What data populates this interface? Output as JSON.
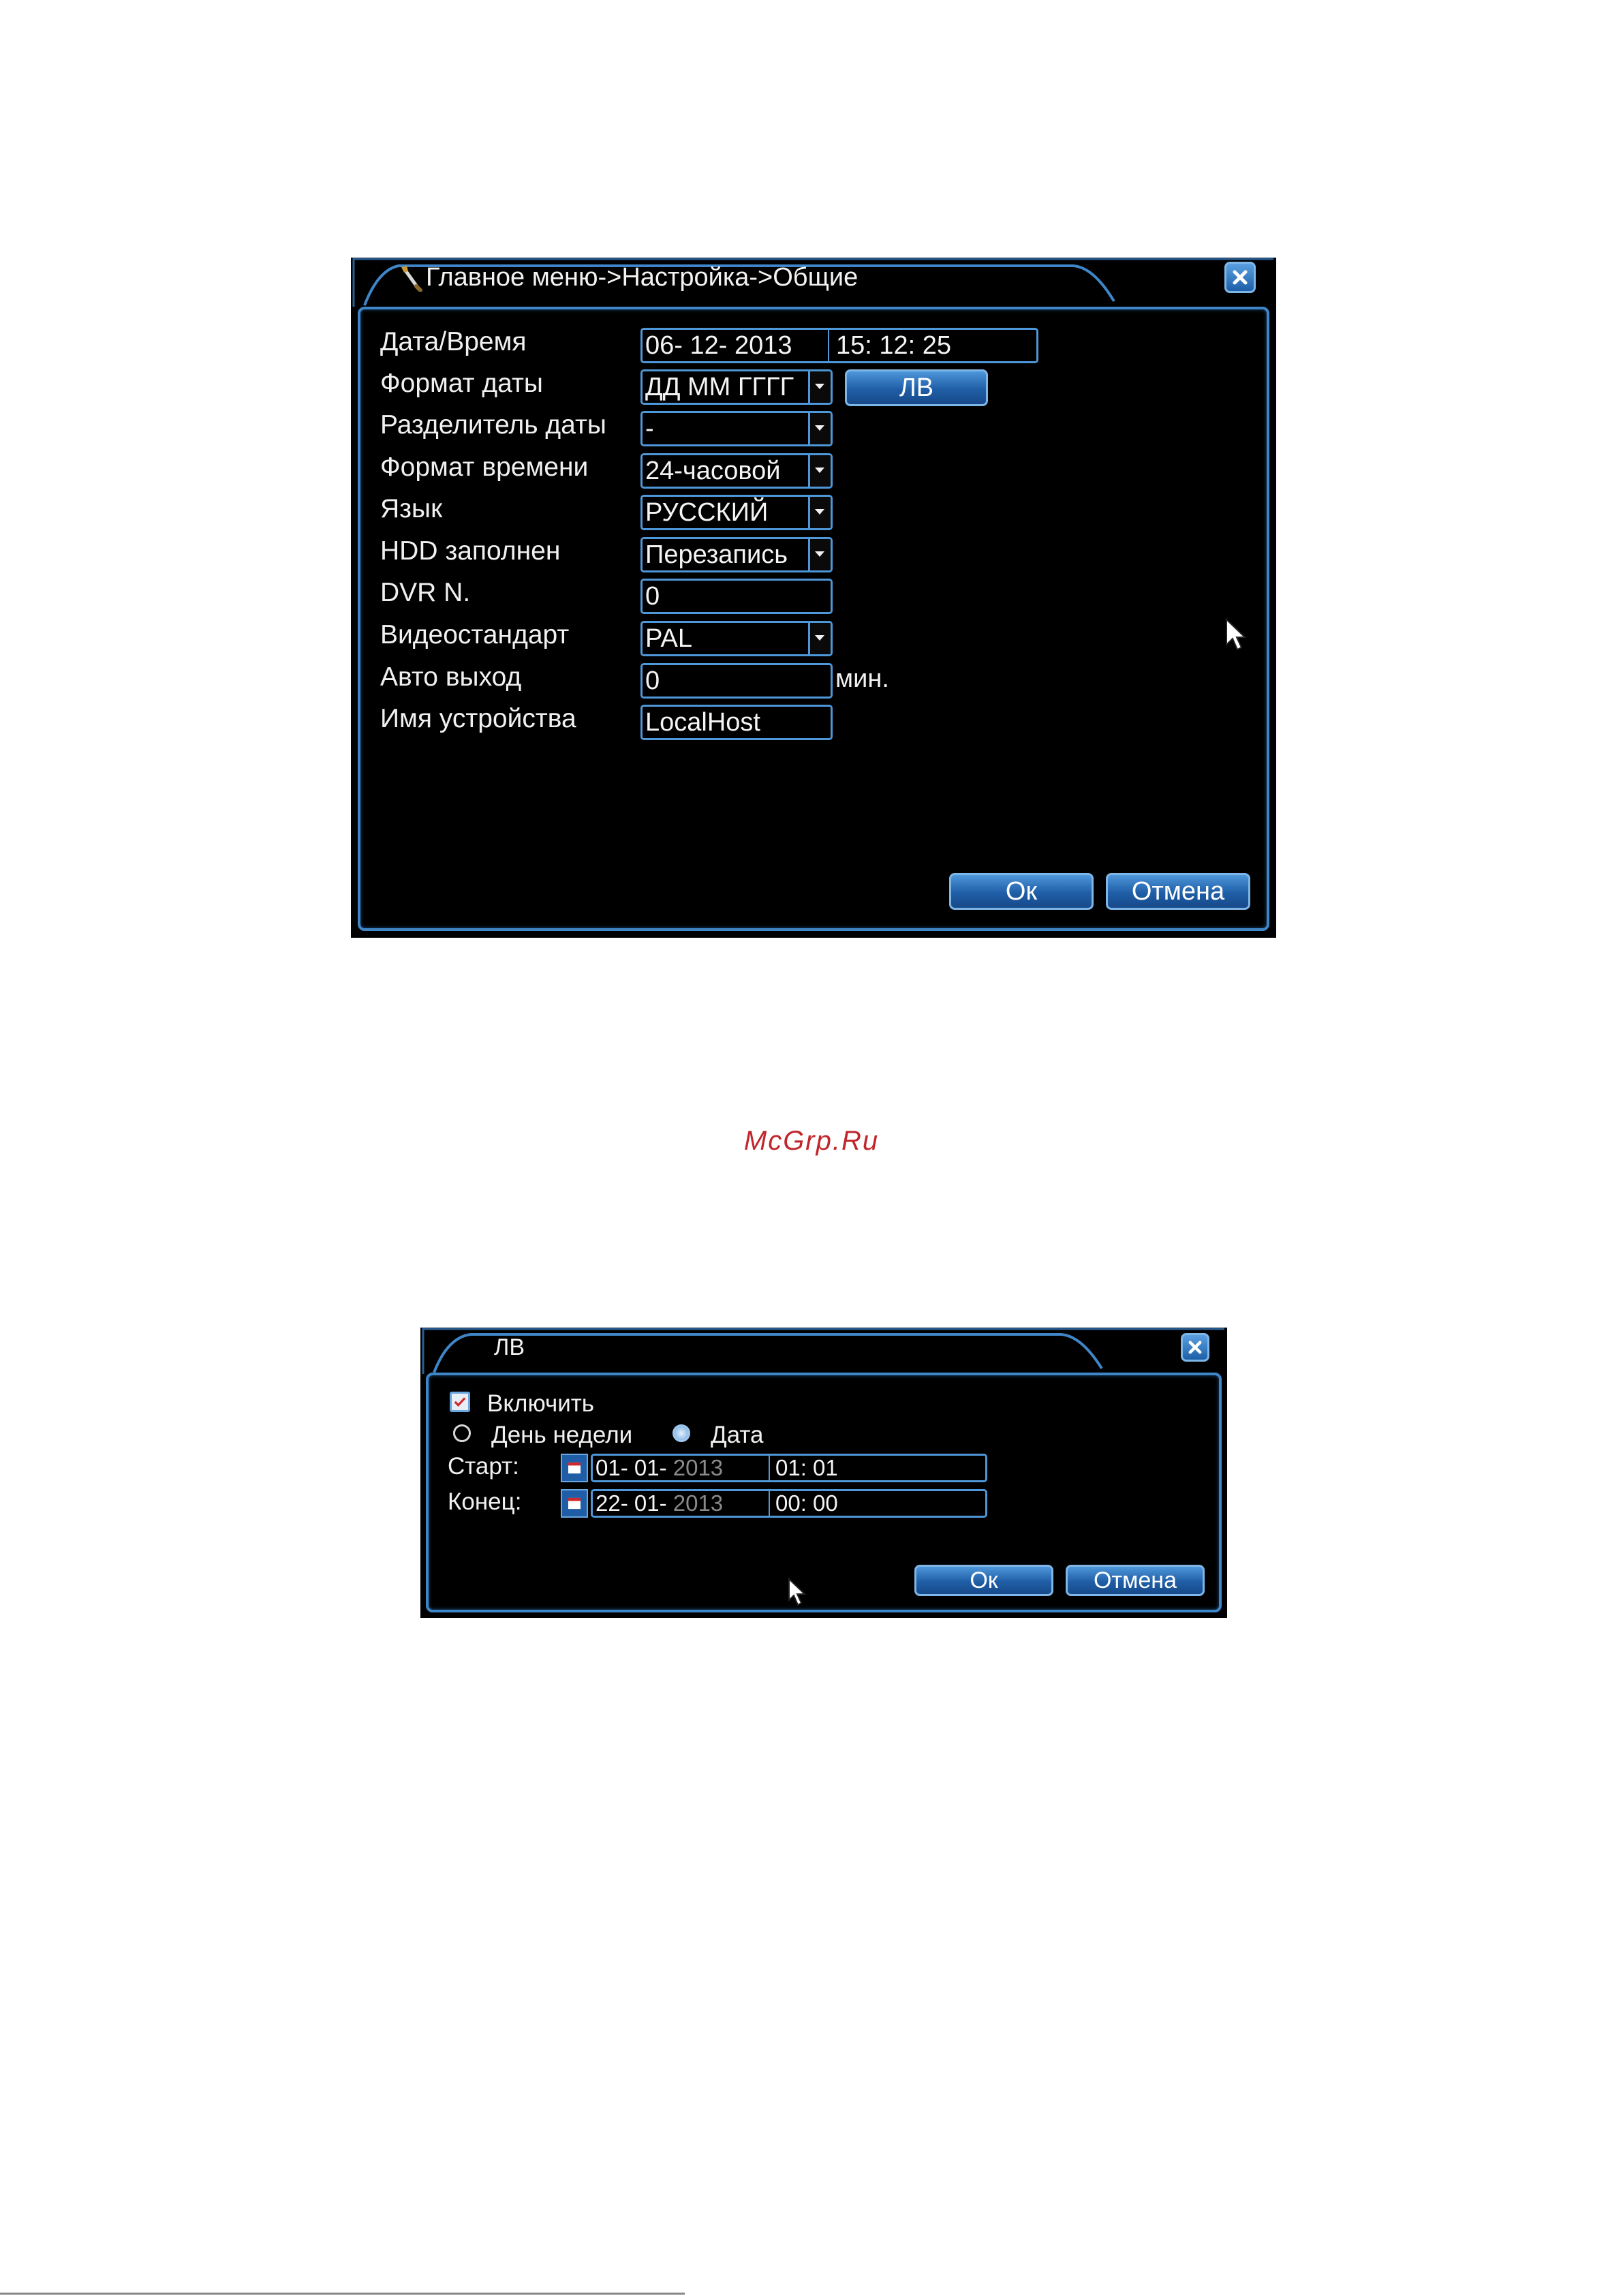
{
  "general_dialog": {
    "title": "Главное меню->Настройка->Общие",
    "rows": [
      {
        "label": "Дата/Время",
        "date": "06- 12- 2013",
        "time": "15: 12: 25"
      },
      {
        "label": "Формат даты",
        "value": "ДД ММ ГГГГ",
        "button": "ЛВ"
      },
      {
        "label": "Разделитель даты",
        "value": "-"
      },
      {
        "label": "Формат времени",
        "value": "24-часовой"
      },
      {
        "label": "Язык",
        "value": "РУССКИЙ"
      },
      {
        "label": "HDD заполнен",
        "value": "Перезапись"
      },
      {
        "label": "DVR N.",
        "value": "0"
      },
      {
        "label": "Видеостандарт",
        "value": "PAL"
      },
      {
        "label": "Авто выход",
        "value": "0",
        "unit": "мин."
      },
      {
        "label": "Имя устройства",
        "value": "LocalHost"
      }
    ],
    "ok_label": "Ок",
    "cancel_label": "Отмена"
  },
  "watermark": "McGrp.Ru",
  "dst_dialog": {
    "title": "ЛВ",
    "enable_label": "Включить",
    "enable_checked": true,
    "weekday_label": "День недели",
    "date_label": "Дата",
    "selected_mode": "Дата",
    "start_label": "Старт:",
    "start_date_dm": "01- 01- ",
    "start_year": "2013",
    "start_time": "01: 01",
    "end_label": "Конец:",
    "end_date_dm": "22- 01- ",
    "end_year": "2013",
    "end_time": "00: 00",
    "ok_label": "Ок",
    "cancel_label": "Отмена"
  },
  "colors": {
    "frame_blue": "#3f86c8",
    "button_blue": "#1f5ea6",
    "watermark_red": "#c0262b"
  }
}
